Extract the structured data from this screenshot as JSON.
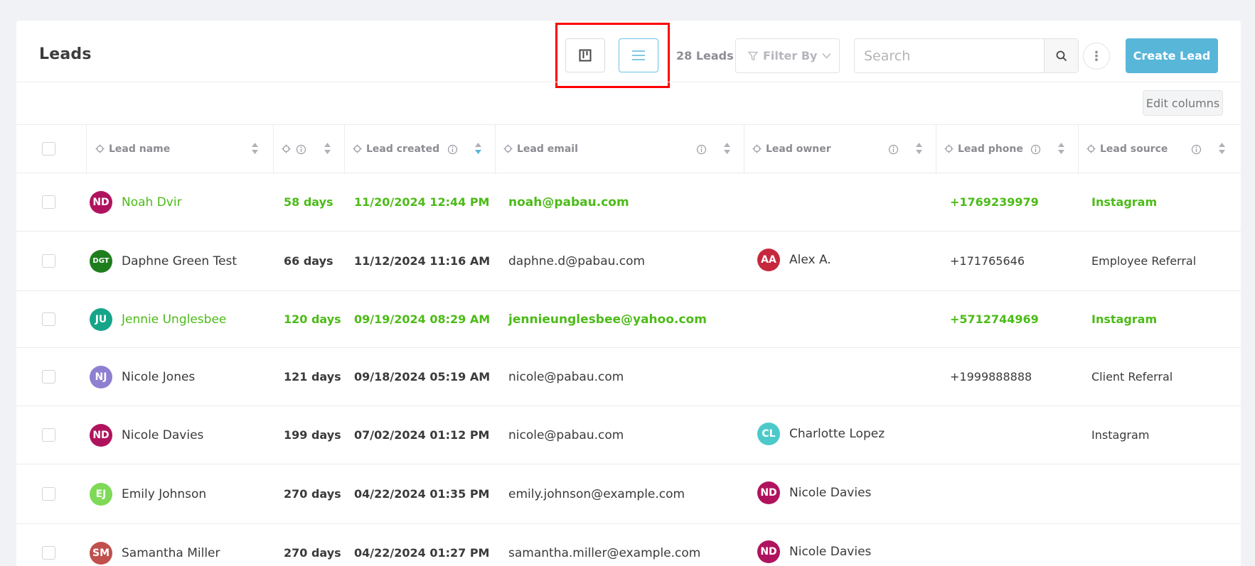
{
  "page_title": "Leads",
  "view_toggle": {
    "kanban_icon": "kanban-icon",
    "list_icon": "list-icon",
    "active": "list"
  },
  "lead_count": "28 Leads",
  "filter": {
    "label": "Filter By",
    "icon": "filter-icon"
  },
  "search": {
    "placeholder": "Search",
    "value": ""
  },
  "create_button": "Create Lead",
  "edit_columns": "Edit columns",
  "colors": {
    "accent": "#58b6d9",
    "highlight_text": "#4cbb17",
    "annotation": "#ff0000"
  },
  "columns": [
    "Lead name",
    "",
    "Lead created",
    "Lead email",
    "Lead owner",
    "Lead phone",
    "Lead source"
  ],
  "rows": [
    {
      "initials": "ND",
      "avatar_color": "#b0135e",
      "name": "Noah Dvir",
      "age": "58 days",
      "created": "11/20/2024 12:44 PM",
      "email": "noah@pabau.com",
      "owner": "",
      "owner_initials": "",
      "owner_color": "",
      "phone": "+1769239979",
      "source": "Instagram",
      "highlight": true
    },
    {
      "initials": "DGT",
      "avatar_color": "#1e7e1e",
      "name": "Daphne Green Test",
      "age": "66 days",
      "created": "11/12/2024 11:16 AM",
      "email": "daphne.d@pabau.com",
      "owner": "Alex A.",
      "owner_initials": "AA",
      "owner_color": "#c5283d",
      "phone": "+171765646",
      "source": "Employee Referral",
      "highlight": false
    },
    {
      "initials": "JU",
      "avatar_color": "#17a589",
      "name": "Jennie Unglesbee",
      "age": "120 days",
      "created": "09/19/2024 08:29 AM",
      "email": "jennieunglesbee@yahoo.com",
      "owner": "",
      "owner_initials": "",
      "owner_color": "",
      "phone": "+5712744969",
      "source": "Instagram",
      "highlight": true
    },
    {
      "initials": "NJ",
      "avatar_color": "#8f7fd0",
      "name": "Nicole Jones",
      "age": "121 days",
      "created": "09/18/2024 05:19 AM",
      "email": "nicole@pabau.com",
      "owner": "",
      "owner_initials": "",
      "owner_color": "",
      "phone": "+1999888888",
      "source": "Client Referral",
      "highlight": false
    },
    {
      "initials": "ND",
      "avatar_color": "#b0135e",
      "name": "Nicole Davies",
      "age": "199 days",
      "created": "07/02/2024 01:12 PM",
      "email": "nicole@pabau.com",
      "owner": "Charlotte Lopez",
      "owner_initials": "CL",
      "owner_color": "#4dc9c9",
      "phone": "",
      "source": "Instagram",
      "highlight": false
    },
    {
      "initials": "EJ",
      "avatar_color": "#7ed957",
      "name": "Emily Johnson",
      "age": "270 days",
      "created": "04/22/2024 01:35 PM",
      "email": "emily.johnson@example.com",
      "owner": "Nicole Davies",
      "owner_initials": "ND",
      "owner_color": "#b0135e",
      "phone": "",
      "source": "",
      "highlight": false
    },
    {
      "initials": "SM",
      "avatar_color": "#c0504d",
      "name": "Samantha Miller",
      "age": "270 days",
      "created": "04/22/2024 01:27 PM",
      "email": "samantha.miller@example.com",
      "owner": "Nicole Davies",
      "owner_initials": "ND",
      "owner_color": "#b0135e",
      "phone": "",
      "source": "",
      "highlight": false
    }
  ]
}
